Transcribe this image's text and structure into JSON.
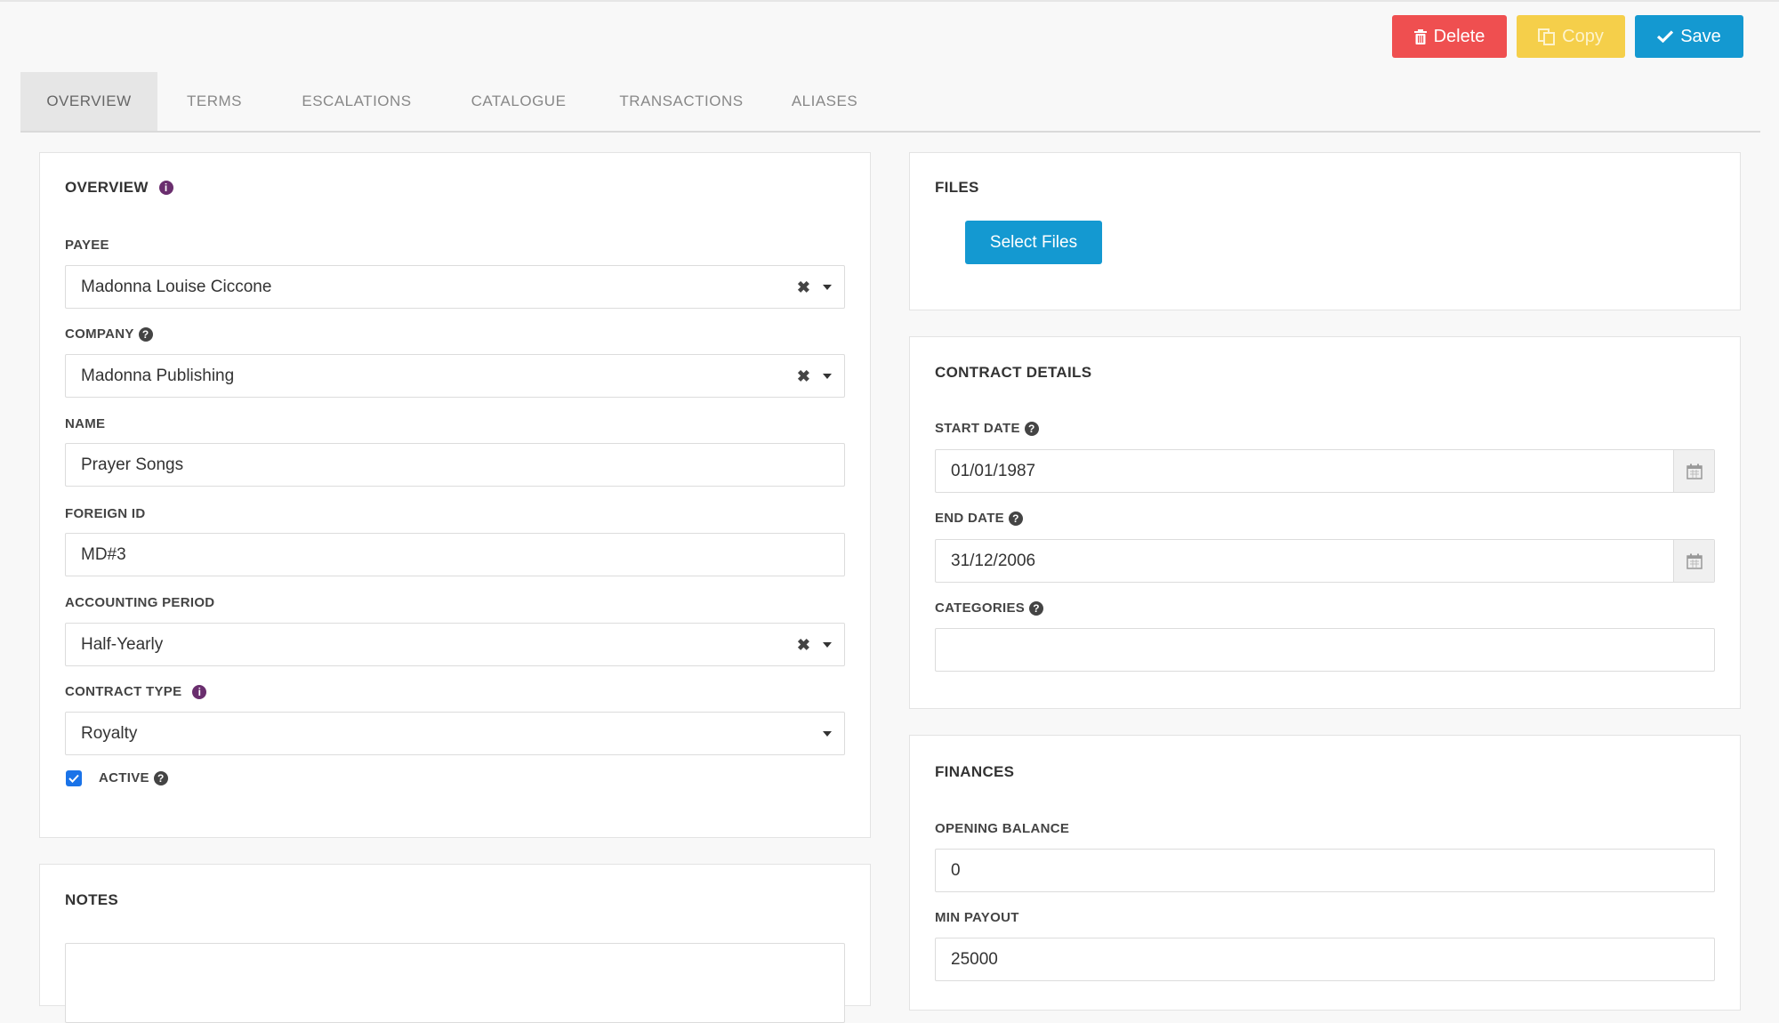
{
  "toolbar": {
    "delete_label": "Delete",
    "copy_label": "Copy",
    "save_label": "Save",
    "colors": {
      "delete": "#ef4f50",
      "copy": "#f5cf4a",
      "save": "#1499d1"
    }
  },
  "tabs": [
    {
      "label": "OVERVIEW",
      "active": true
    },
    {
      "label": "TERMS"
    },
    {
      "label": "ESCALATIONS"
    },
    {
      "label": "CATALOGUE"
    },
    {
      "label": "TRANSACTIONS"
    },
    {
      "label": "ALIASES"
    }
  ],
  "overview": {
    "title": "OVERVIEW",
    "payee": {
      "label": "PAYEE",
      "value": "Madonna Louise Ciccone"
    },
    "company": {
      "label": "COMPANY",
      "value": "Madonna Publishing"
    },
    "name": {
      "label": "NAME",
      "value": "Prayer Songs"
    },
    "foreign_id": {
      "label": "FOREIGN ID",
      "value": "MD#3"
    },
    "accounting_period": {
      "label": "ACCOUNTING PERIOD",
      "value": "Half-Yearly"
    },
    "contract_type": {
      "label": "CONTRACT TYPE",
      "value": "Royalty"
    },
    "active": {
      "label": "ACTIVE",
      "checked": true
    }
  },
  "notes": {
    "title": "NOTES",
    "value": ""
  },
  "files": {
    "title": "FILES",
    "select_label": "Select Files"
  },
  "contract_details": {
    "title": "CONTRACT DETAILS",
    "start_date": {
      "label": "START DATE",
      "value": "01/01/1987"
    },
    "end_date": {
      "label": "END DATE",
      "value": "31/12/2006"
    },
    "categories": {
      "label": "CATEGORIES",
      "value": ""
    }
  },
  "finances": {
    "title": "FINANCES",
    "opening_balance": {
      "label": "OPENING BALANCE",
      "value": "0"
    },
    "min_payout": {
      "label": "MIN PAYOUT",
      "value": "25000"
    }
  },
  "icons": {
    "info": "info-icon",
    "help": "question-circle-icon",
    "calendar": "calendar-icon",
    "trash": "trash-icon",
    "copy": "copy-icon",
    "check": "check-icon"
  }
}
